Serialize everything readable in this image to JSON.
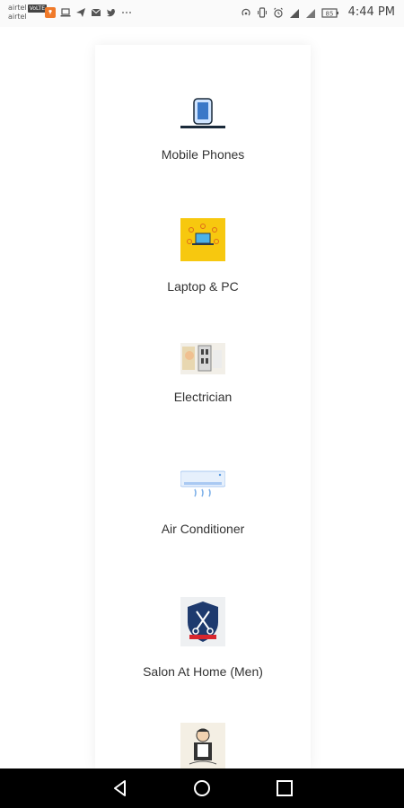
{
  "status_bar": {
    "carrier_1": "airtel",
    "volte": "VoLTE",
    "carrier_2": "airtel",
    "time": "4:44 PM",
    "notification_icons": [
      "swiggy-icon",
      "laptop-icon",
      "telegram-icon",
      "mail-icon",
      "twitter-icon",
      "more-dots-icon"
    ],
    "system_icons": [
      "hotspot-icon",
      "vibrate-icon",
      "alarm-icon",
      "signal-icon",
      "signal-icon",
      "battery-icon"
    ],
    "battery_label": "85"
  },
  "categories": [
    {
      "label": "Mobile Phones",
      "icon": "mobile-phone-icon"
    },
    {
      "label": "Laptop & PC",
      "icon": "laptop-icon"
    },
    {
      "label": "Electrician",
      "icon": "electrician-icon"
    },
    {
      "label": "Air Conditioner",
      "icon": "air-conditioner-icon"
    },
    {
      "label": "Salon At Home (Men)",
      "icon": "salon-icon"
    },
    {
      "label": "",
      "icon": "handyman-icon"
    }
  ],
  "nav_bar": {
    "buttons": [
      "back-icon",
      "home-icon",
      "recents-icon"
    ]
  },
  "colors": {
    "laptop_tile": "#f7c80f",
    "salon_shield": "#1e3a6e",
    "ac_blue": "#a9c9f2"
  }
}
